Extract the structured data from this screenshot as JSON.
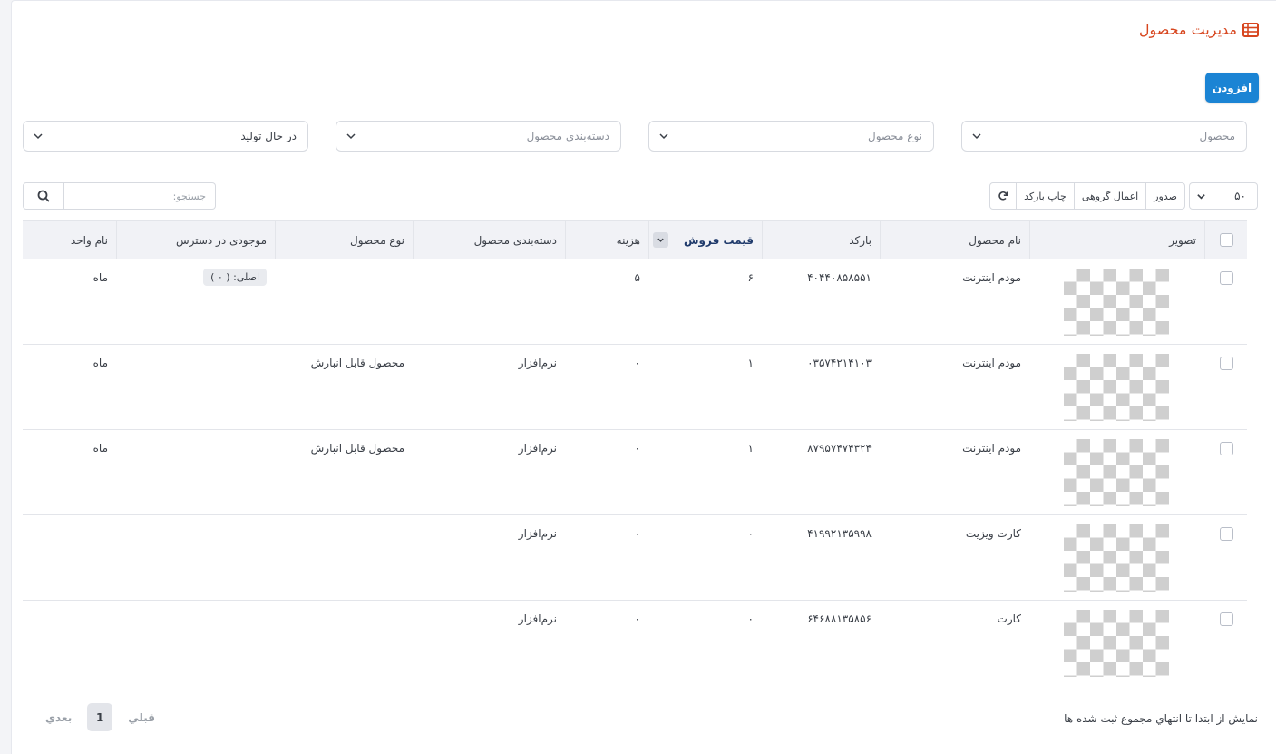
{
  "header": {
    "title": "مدیریت محصول",
    "title_icon": "table-list-icon",
    "accent_color": "#d7461f"
  },
  "add_button": {
    "label": "افزودن",
    "color": "#1b84d4"
  },
  "filters": {
    "product": {
      "placeholder": "محصول"
    },
    "product_type": {
      "placeholder": "نوع محصول"
    },
    "product_category": {
      "placeholder": "دسته‌بندی محصول"
    },
    "status": {
      "value": "در حال تولید"
    }
  },
  "toolbar": {
    "page_size": "۵۰",
    "export_label": "صدور",
    "bulk_action_label": "اعمال گروهی",
    "print_barcode_label": "چاپ بارکد",
    "refresh_icon": "refresh-icon"
  },
  "search": {
    "placeholder": "جستجو:"
  },
  "table": {
    "columns": {
      "image": "تصویر",
      "name": "نام محصول",
      "barcode": "بارکد",
      "sale_price": "قیمت فروش",
      "cost": "هزینه",
      "category": "دسته‌بندی محصول",
      "type": "نوع محصول",
      "stock": "موجودی در دسترس",
      "unit": "نام واحد"
    },
    "rows": [
      {
        "name": "مودم اینترنت",
        "barcode": "۴۰۴۴۰۸۵۸۵۵۱",
        "sale_price": "۶",
        "cost": "۵",
        "category": "",
        "type": "",
        "stock": "اصلی: ( ۰ )",
        "unit": "ماه"
      },
      {
        "name": "مودم اینترنت",
        "barcode": "۰۳۵۷۴۲۱۴۱۰۳",
        "sale_price": "۱",
        "cost": "۰",
        "category": "نرم‌افزار",
        "type": "محصول قابل انبارش",
        "stock": "",
        "unit": "ماه"
      },
      {
        "name": "مودم اینترنت",
        "barcode": "۸۷۹۵۷۴۷۴۳۲۴",
        "sale_price": "۱",
        "cost": "۰",
        "category": "نرم‌افزار",
        "type": "محصول قابل انبارش",
        "stock": "",
        "unit": "ماه"
      },
      {
        "name": "کارت ویزیت",
        "barcode": "۴۱۹۹۲۱۳۵۹۹۸",
        "sale_price": "۰",
        "cost": "۰",
        "category": "نرم‌افزار",
        "type": "",
        "stock": "",
        "unit": ""
      },
      {
        "name": "کارت",
        "barcode": "۶۴۶۸۸۱۳۵۸۵۶",
        "sale_price": "۰",
        "cost": "۰",
        "category": "نرم‌افزار",
        "type": "",
        "stock": "",
        "unit": ""
      }
    ]
  },
  "footer": {
    "info": "نمايش از ابتدا تا انتهاي مجموع ثبت شده ها",
    "prev_label": "قبلي",
    "page": "1",
    "next_label": "بعدي"
  }
}
